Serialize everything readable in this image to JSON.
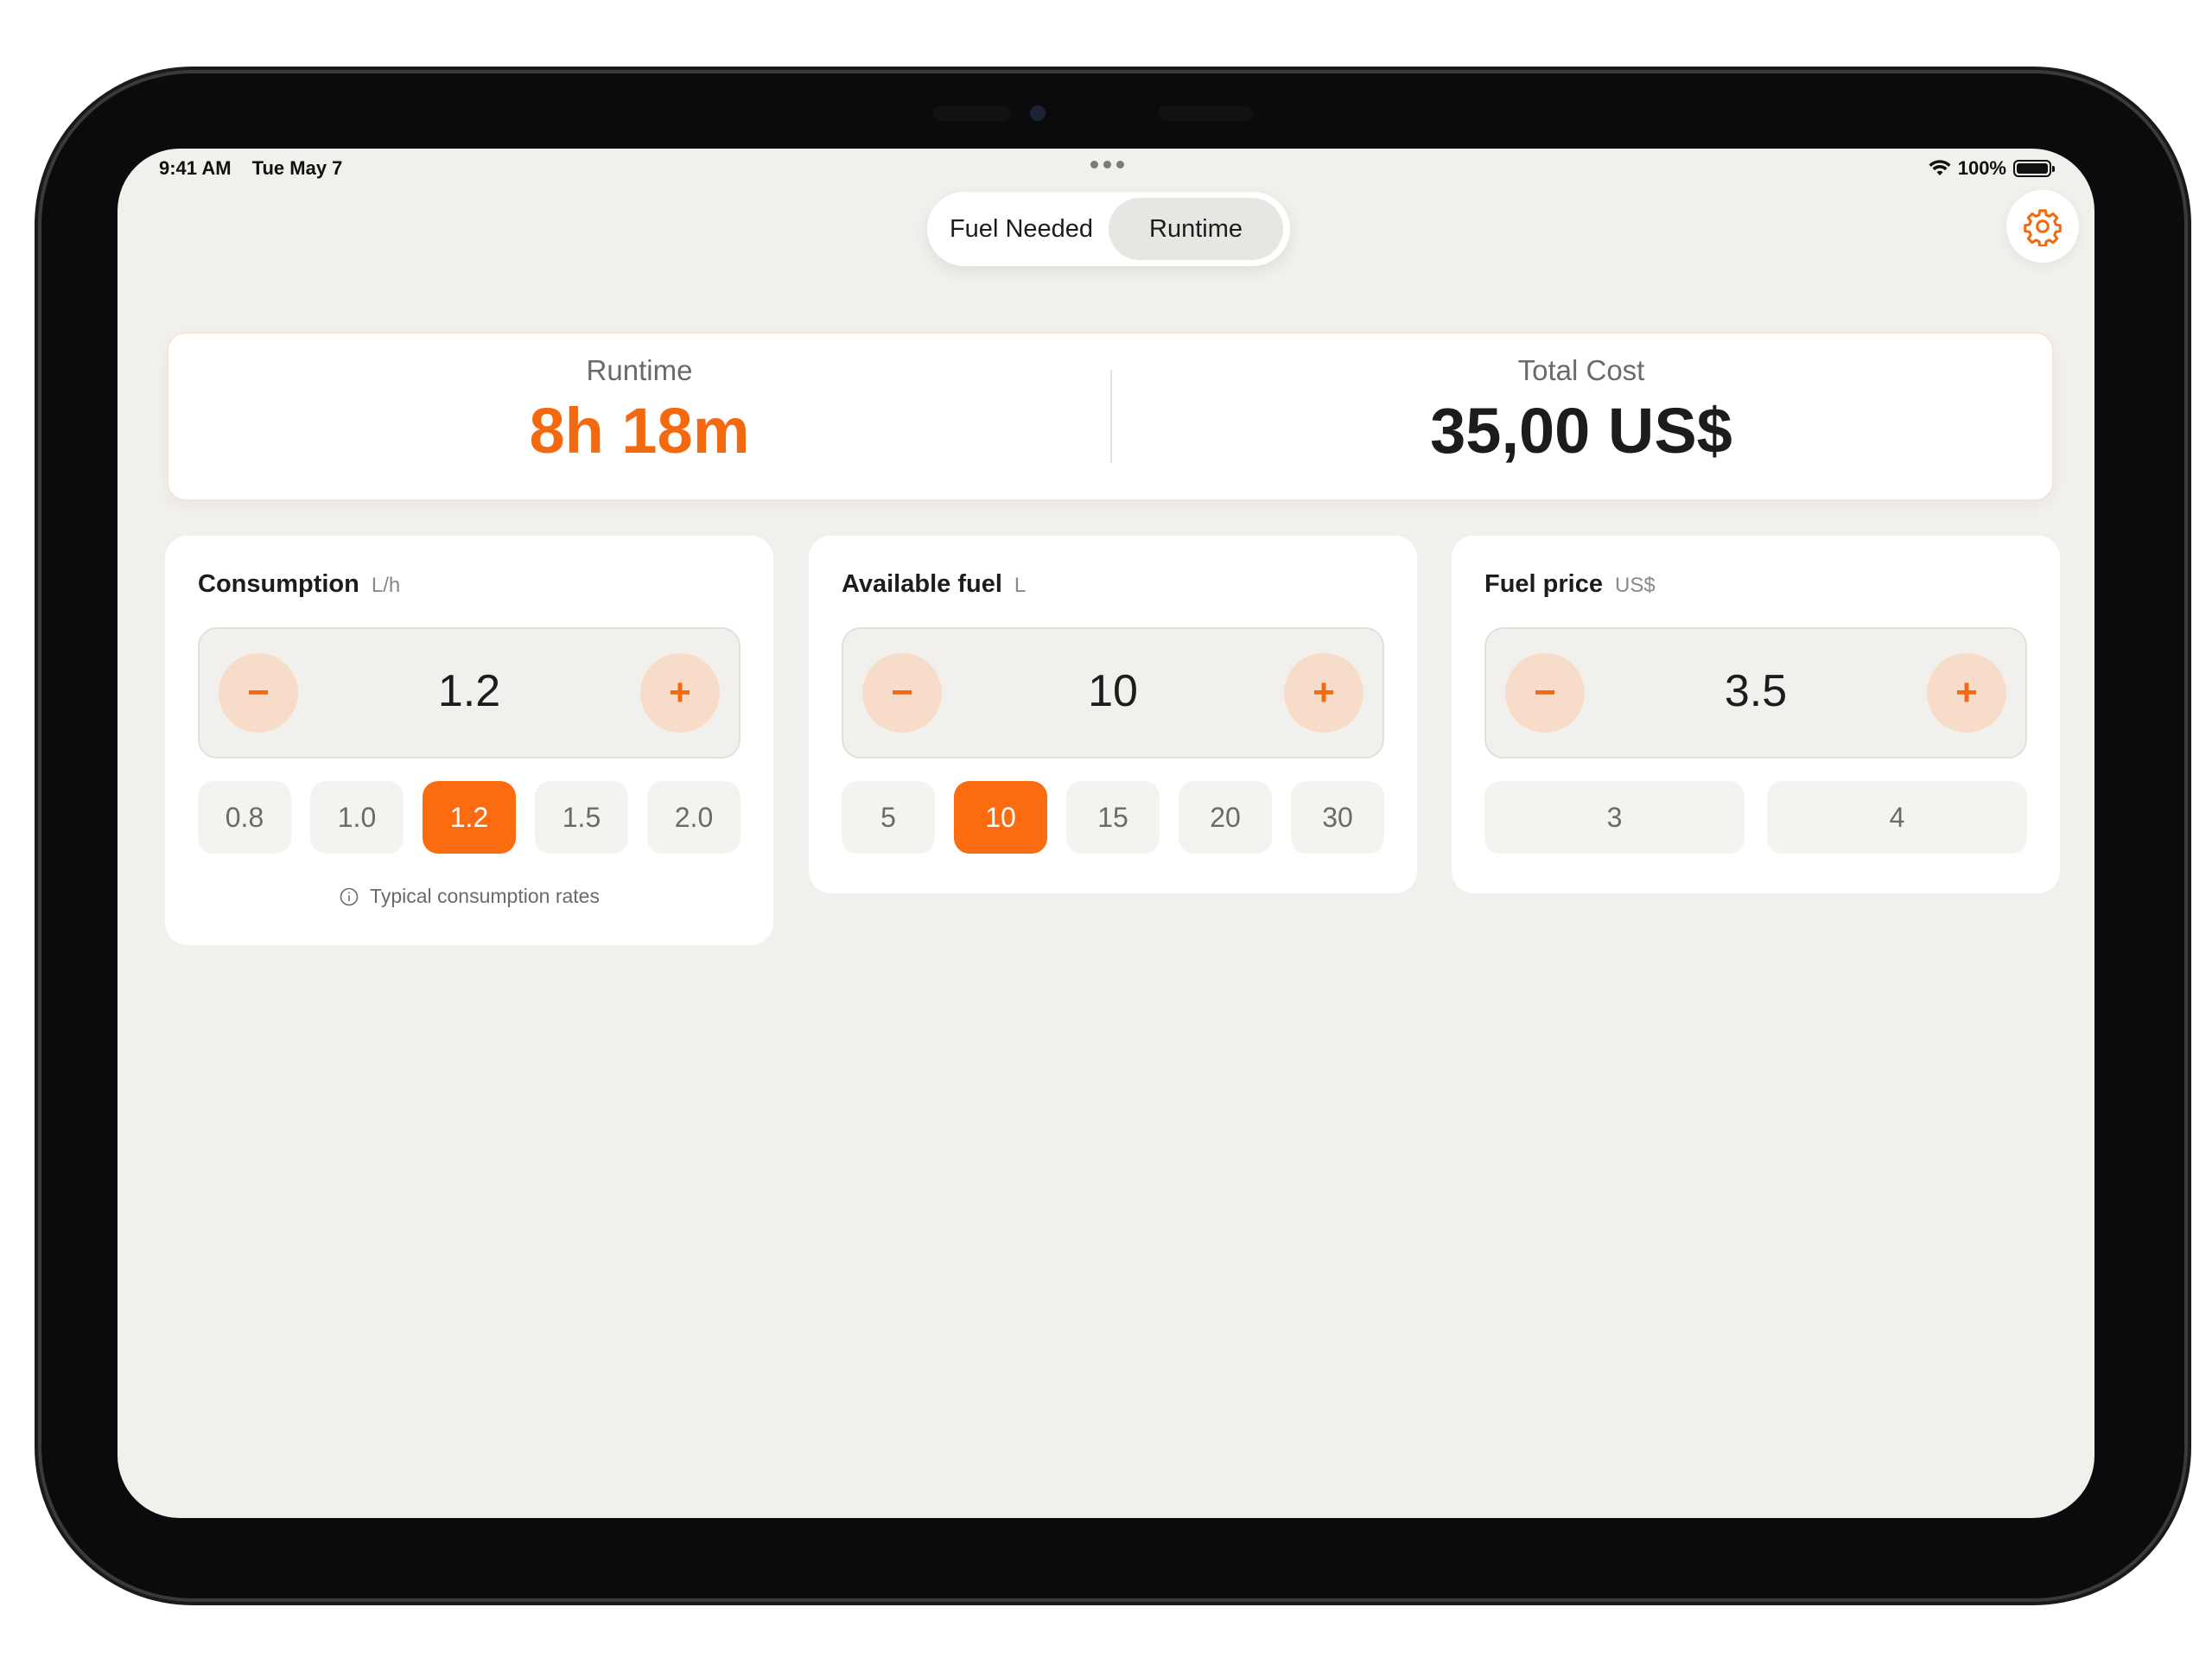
{
  "status_bar": {
    "time": "9:41 AM",
    "date": "Tue May 7",
    "battery": "100%"
  },
  "mode_toggle": {
    "options": [
      "Fuel Needed",
      "Runtime"
    ],
    "selected": "Runtime"
  },
  "settings": {
    "icon": "gear-icon"
  },
  "results": {
    "runtime_label": "Runtime",
    "runtime_value": "8h 18m",
    "cost_label": "Total Cost",
    "cost_value": "35,00 US$"
  },
  "consumption": {
    "title": "Consumption",
    "unit": "L/h",
    "value": "1.2",
    "presets": [
      "0.8",
      "1.0",
      "1.2",
      "1.5",
      "2.0"
    ],
    "selected": "1.2",
    "hint": "Typical consumption rates"
  },
  "available_fuel": {
    "title": "Available fuel",
    "unit": "L",
    "value": "10",
    "presets": [
      "5",
      "10",
      "15",
      "20",
      "30"
    ],
    "selected": "10"
  },
  "fuel_price": {
    "title": "Fuel price",
    "unit": "US$",
    "value": "3.5",
    "presets": [
      "3",
      "4"
    ]
  },
  "stepper": {
    "minus_symbol": "−",
    "plus_symbol": "+"
  },
  "colors": {
    "accent": "#F4690F",
    "background": "#F2F0EC",
    "card": "#FFFFFF",
    "stepper_button": "#F7DCC9"
  }
}
